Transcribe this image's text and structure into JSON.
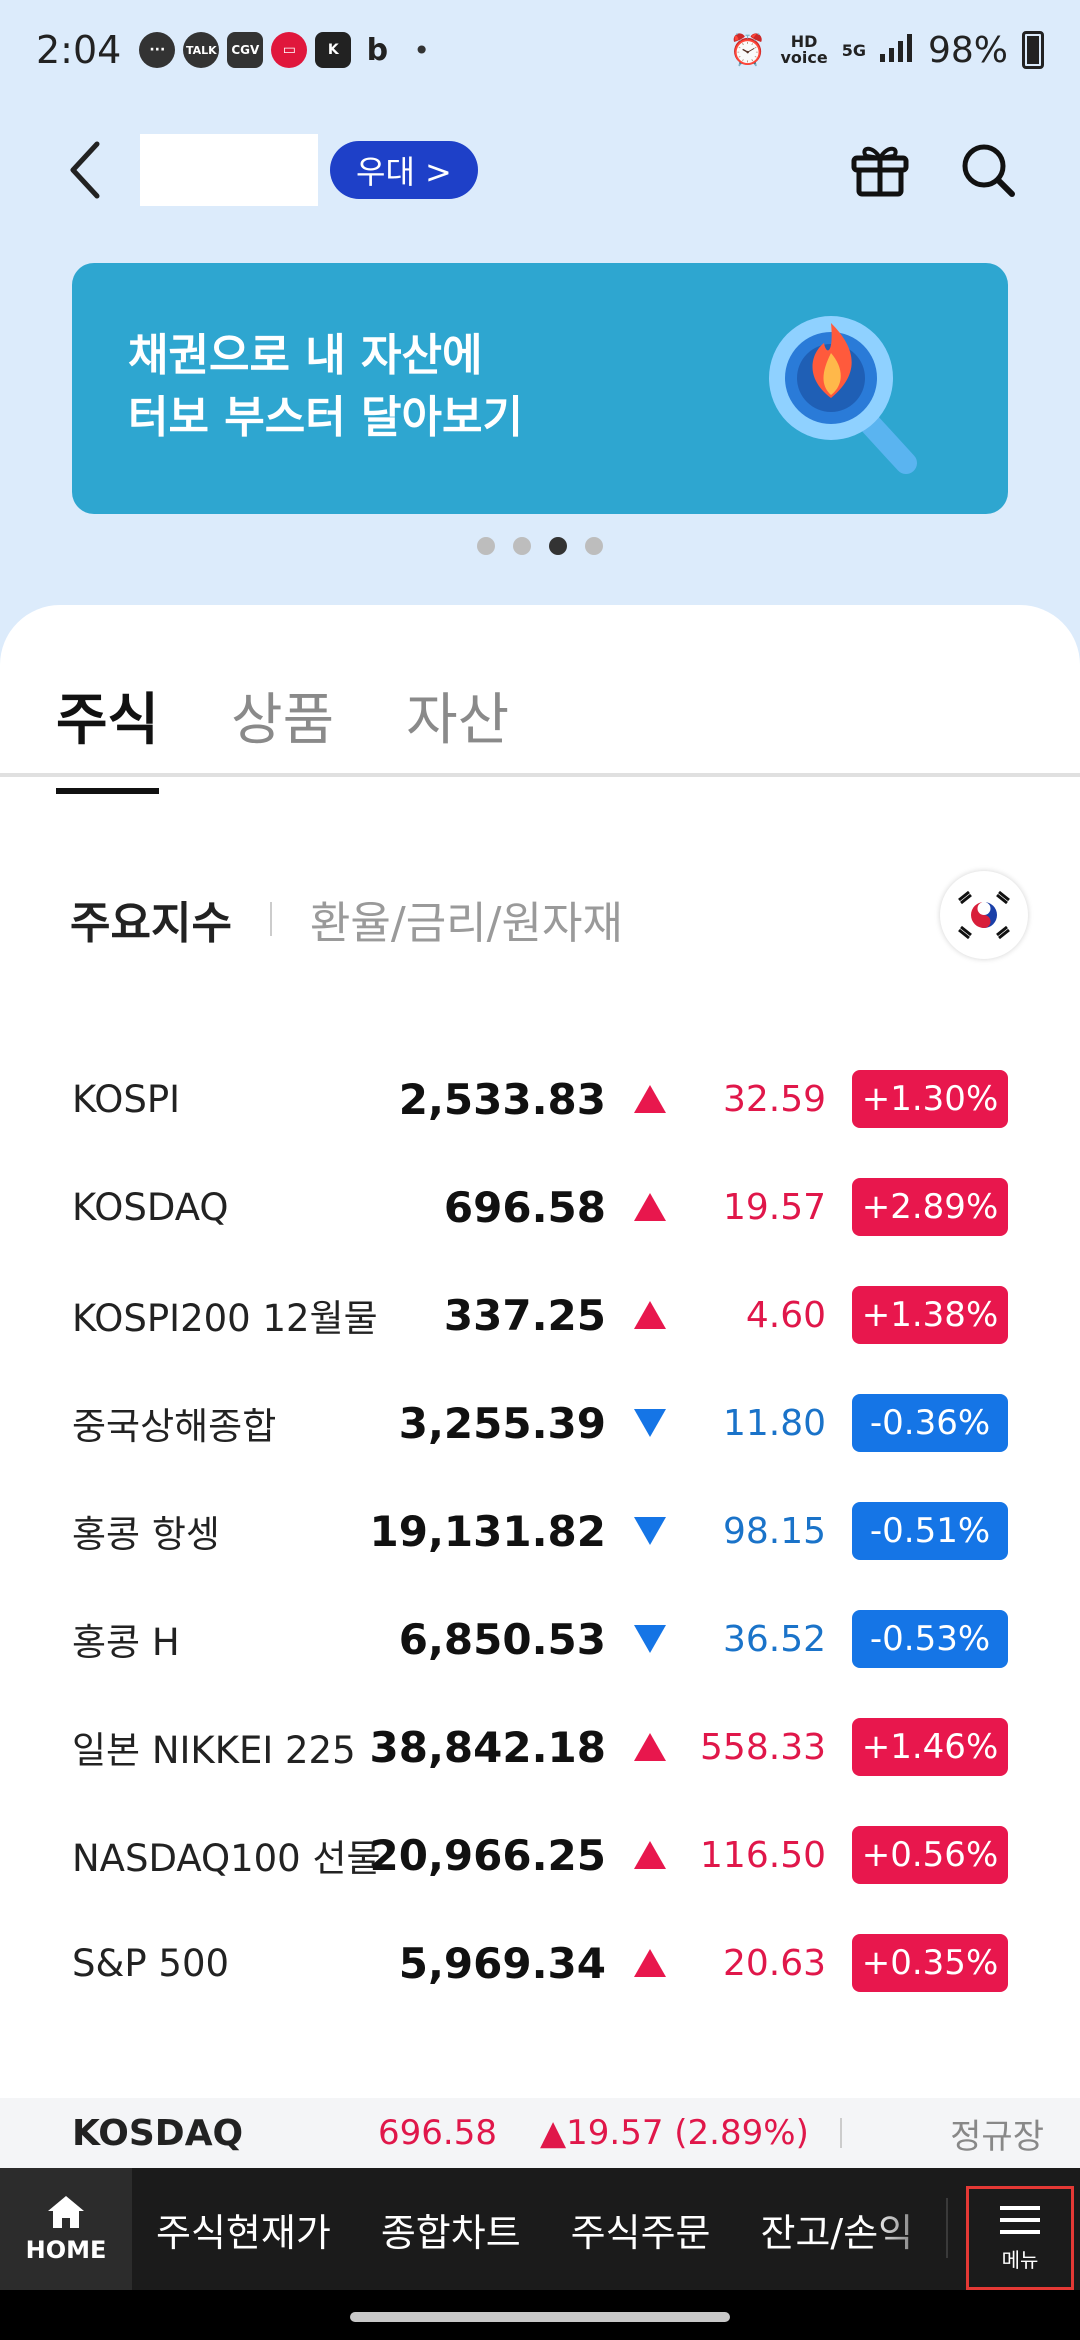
{
  "status_bar": {
    "time": "2:04",
    "battery": "98%",
    "notification_icons": [
      "talk-icon",
      "kakaotalk-icon",
      "cgv-icon",
      "coupang-icon",
      "k-icon",
      "b-icon"
    ]
  },
  "header": {
    "tier_label": "우대 >",
    "icons": [
      "gift-icon",
      "search-icon"
    ]
  },
  "banner": {
    "line1": "채권으로 내 자산에",
    "line2": "터보 부스터 달아보기",
    "page_count": 4,
    "active_page": 3
  },
  "tabs": [
    {
      "label": "주식",
      "active": true
    },
    {
      "label": "상품",
      "active": false
    },
    {
      "label": "자산",
      "active": false
    }
  ],
  "subtabs": [
    {
      "label": "주요지수",
      "active": true
    },
    {
      "label": "환율/금리/원자재",
      "active": false
    }
  ],
  "indices": [
    {
      "name": "KOSPI",
      "value": "2,533.83",
      "direction": "up",
      "change": "32.59",
      "pct": "+1.30%"
    },
    {
      "name": "KOSDAQ",
      "value": "696.58",
      "direction": "up",
      "change": "19.57",
      "pct": "+2.89%"
    },
    {
      "name": "KOSPI200 12월물",
      "value": "337.25",
      "direction": "up",
      "change": "4.60",
      "pct": "+1.38%"
    },
    {
      "name": "중국상해종합",
      "value": "3,255.39",
      "direction": "down",
      "change": "11.80",
      "pct": "-0.36%"
    },
    {
      "name": "홍콩 항셍",
      "value": "19,131.82",
      "direction": "down",
      "change": "98.15",
      "pct": "-0.51%"
    },
    {
      "name": "홍콩 H",
      "value": "6,850.53",
      "direction": "down",
      "change": "36.52",
      "pct": "-0.53%"
    },
    {
      "name": "일본 NIKKEI 225",
      "value": "38,842.18",
      "direction": "up",
      "change": "558.33",
      "pct": "+1.46%"
    },
    {
      "name": "NASDAQ100 선물",
      "value": "20,966.25",
      "direction": "up",
      "change": "116.50",
      "pct": "+0.56%"
    },
    {
      "name": "S&P 500",
      "value": "5,969.34",
      "direction": "up",
      "change": "20.63",
      "pct": "+0.35%"
    }
  ],
  "ticker": {
    "name": "KOSDAQ",
    "price": "696.58",
    "change": "▲19.57 (2.89%)",
    "session": "정규장"
  },
  "bottom_nav": {
    "home_label": "HOME",
    "items": [
      "주식현재가",
      "종합차트",
      "주식주문",
      "잔고/손익"
    ],
    "menu_label": "메뉴"
  },
  "colors": {
    "up": "#e8174d",
    "down": "#1575e6",
    "tier_badge": "#1e40c8",
    "banner": "#2ea6d0"
  }
}
